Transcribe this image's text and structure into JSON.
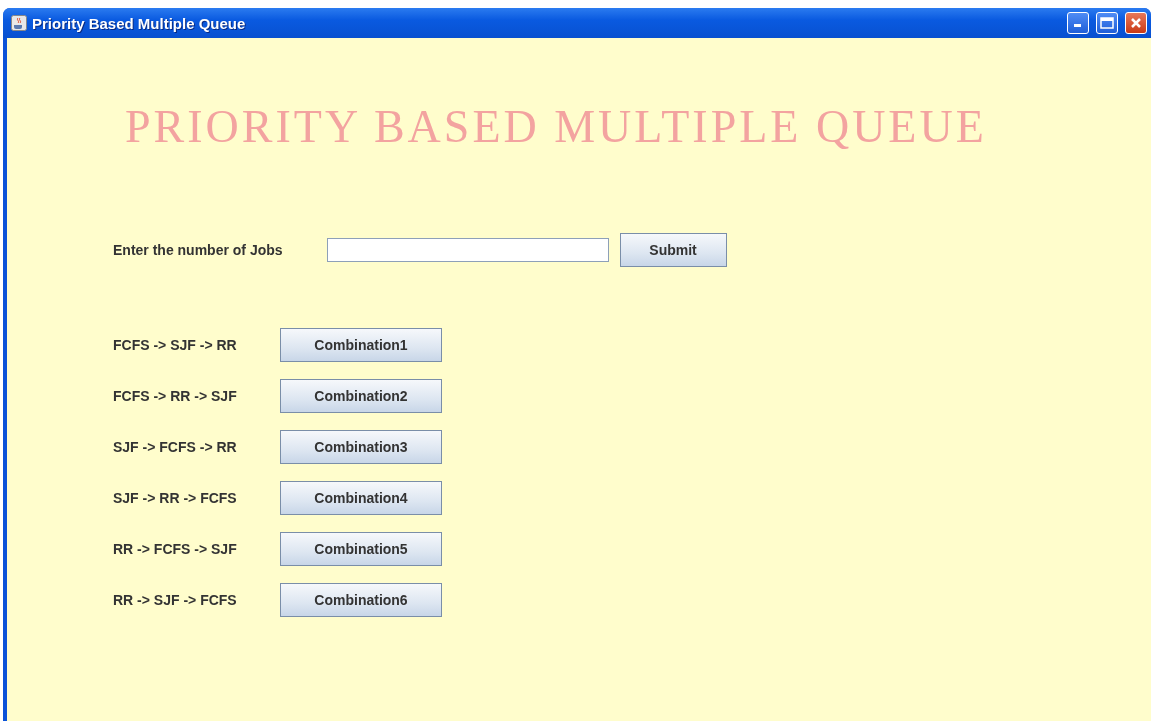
{
  "window": {
    "title": "Priority Based Multiple Queue"
  },
  "heading": "PRIORITY BASED MULTIPLE QUEUE",
  "jobs": {
    "label": "Enter the number of Jobs",
    "button": "Submit"
  },
  "combinations": [
    {
      "order": "FCFS -> SJF -> RR",
      "button": "Combination1"
    },
    {
      "order": "FCFS -> RR -> SJF",
      "button": "Combination2"
    },
    {
      "order": "SJF -> FCFS -> RR",
      "button": "Combination3"
    },
    {
      "order": "SJF -> RR -> FCFS",
      "button": "Combination4"
    },
    {
      "order": "RR -> FCFS -> SJF",
      "button": "Combination5"
    },
    {
      "order": "RR -> SJF -> FCFS",
      "button": "Combination6"
    }
  ]
}
